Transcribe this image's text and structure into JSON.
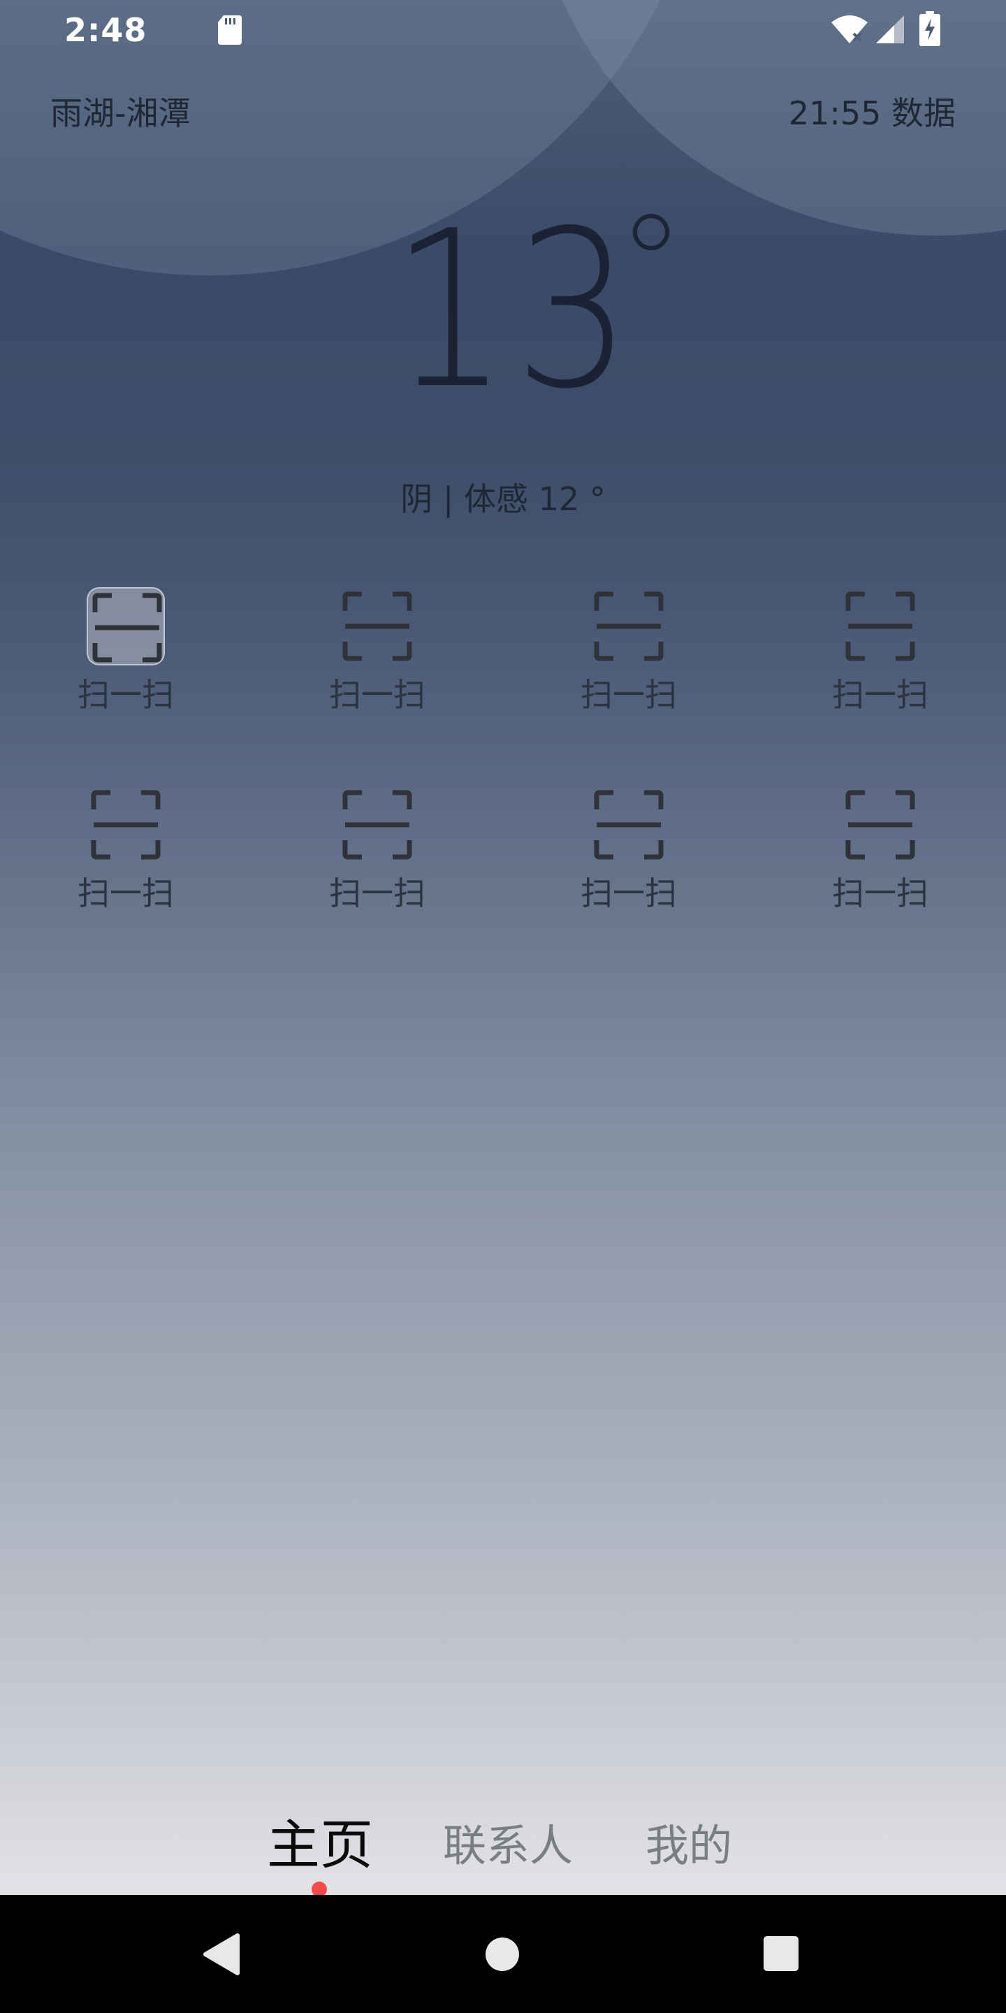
{
  "status_bar": {
    "time": "2:48",
    "icons": [
      "sd-card-icon",
      "wifi-icon",
      "signal-icon",
      "battery-charging-icon"
    ]
  },
  "header": {
    "location": "雨湖-湘潭",
    "update_info": "21:55 数据"
  },
  "weather": {
    "temperature": "13",
    "condition": "阴 | 体感 12 °"
  },
  "grid": {
    "items": [
      {
        "label": "扫一扫",
        "icon": "scan-icon",
        "highlighted": true
      },
      {
        "label": "扫一扫",
        "icon": "scan-icon"
      },
      {
        "label": "扫一扫",
        "icon": "scan-icon"
      },
      {
        "label": "扫一扫",
        "icon": "scan-icon"
      },
      {
        "label": "扫一扫",
        "icon": "scan-icon"
      },
      {
        "label": "扫一扫",
        "icon": "scan-icon"
      },
      {
        "label": "扫一扫",
        "icon": "scan-icon"
      },
      {
        "label": "扫一扫",
        "icon": "scan-icon"
      }
    ]
  },
  "tabs": {
    "items": [
      {
        "label": "主页",
        "active": true
      },
      {
        "label": "联系人",
        "active": false
      },
      {
        "label": "我的",
        "active": false
      }
    ],
    "accent_color": "#f24a4a"
  },
  "nav_bar": {
    "icons": [
      "back-icon",
      "home-icon",
      "recents-icon"
    ]
  }
}
